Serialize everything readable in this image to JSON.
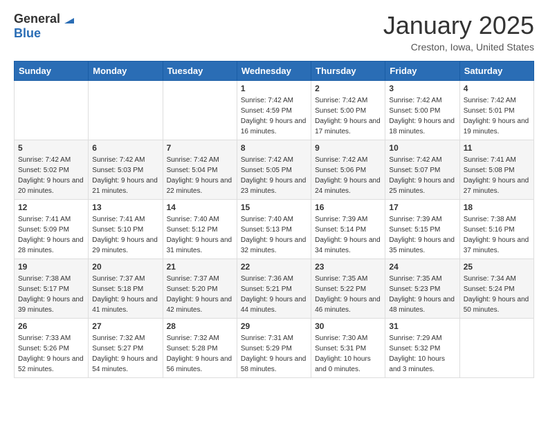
{
  "logo": {
    "general": "General",
    "blue": "Blue"
  },
  "header": {
    "month": "January 2025",
    "location": "Creston, Iowa, United States"
  },
  "weekdays": [
    "Sunday",
    "Monday",
    "Tuesday",
    "Wednesday",
    "Thursday",
    "Friday",
    "Saturday"
  ],
  "weeks": [
    [
      {
        "day": "",
        "sunrise": "",
        "sunset": "",
        "daylight": ""
      },
      {
        "day": "",
        "sunrise": "",
        "sunset": "",
        "daylight": ""
      },
      {
        "day": "",
        "sunrise": "",
        "sunset": "",
        "daylight": ""
      },
      {
        "day": "1",
        "sunrise": "Sunrise: 7:42 AM",
        "sunset": "Sunset: 4:59 PM",
        "daylight": "Daylight: 9 hours and 16 minutes."
      },
      {
        "day": "2",
        "sunrise": "Sunrise: 7:42 AM",
        "sunset": "Sunset: 5:00 PM",
        "daylight": "Daylight: 9 hours and 17 minutes."
      },
      {
        "day": "3",
        "sunrise": "Sunrise: 7:42 AM",
        "sunset": "Sunset: 5:00 PM",
        "daylight": "Daylight: 9 hours and 18 minutes."
      },
      {
        "day": "4",
        "sunrise": "Sunrise: 7:42 AM",
        "sunset": "Sunset: 5:01 PM",
        "daylight": "Daylight: 9 hours and 19 minutes."
      }
    ],
    [
      {
        "day": "5",
        "sunrise": "Sunrise: 7:42 AM",
        "sunset": "Sunset: 5:02 PM",
        "daylight": "Daylight: 9 hours and 20 minutes."
      },
      {
        "day": "6",
        "sunrise": "Sunrise: 7:42 AM",
        "sunset": "Sunset: 5:03 PM",
        "daylight": "Daylight: 9 hours and 21 minutes."
      },
      {
        "day": "7",
        "sunrise": "Sunrise: 7:42 AM",
        "sunset": "Sunset: 5:04 PM",
        "daylight": "Daylight: 9 hours and 22 minutes."
      },
      {
        "day": "8",
        "sunrise": "Sunrise: 7:42 AM",
        "sunset": "Sunset: 5:05 PM",
        "daylight": "Daylight: 9 hours and 23 minutes."
      },
      {
        "day": "9",
        "sunrise": "Sunrise: 7:42 AM",
        "sunset": "Sunset: 5:06 PM",
        "daylight": "Daylight: 9 hours and 24 minutes."
      },
      {
        "day": "10",
        "sunrise": "Sunrise: 7:42 AM",
        "sunset": "Sunset: 5:07 PM",
        "daylight": "Daylight: 9 hours and 25 minutes."
      },
      {
        "day": "11",
        "sunrise": "Sunrise: 7:41 AM",
        "sunset": "Sunset: 5:08 PM",
        "daylight": "Daylight: 9 hours and 27 minutes."
      }
    ],
    [
      {
        "day": "12",
        "sunrise": "Sunrise: 7:41 AM",
        "sunset": "Sunset: 5:09 PM",
        "daylight": "Daylight: 9 hours and 28 minutes."
      },
      {
        "day": "13",
        "sunrise": "Sunrise: 7:41 AM",
        "sunset": "Sunset: 5:10 PM",
        "daylight": "Daylight: 9 hours and 29 minutes."
      },
      {
        "day": "14",
        "sunrise": "Sunrise: 7:40 AM",
        "sunset": "Sunset: 5:12 PM",
        "daylight": "Daylight: 9 hours and 31 minutes."
      },
      {
        "day": "15",
        "sunrise": "Sunrise: 7:40 AM",
        "sunset": "Sunset: 5:13 PM",
        "daylight": "Daylight: 9 hours and 32 minutes."
      },
      {
        "day": "16",
        "sunrise": "Sunrise: 7:39 AM",
        "sunset": "Sunset: 5:14 PM",
        "daylight": "Daylight: 9 hours and 34 minutes."
      },
      {
        "day": "17",
        "sunrise": "Sunrise: 7:39 AM",
        "sunset": "Sunset: 5:15 PM",
        "daylight": "Daylight: 9 hours and 35 minutes."
      },
      {
        "day": "18",
        "sunrise": "Sunrise: 7:38 AM",
        "sunset": "Sunset: 5:16 PM",
        "daylight": "Daylight: 9 hours and 37 minutes."
      }
    ],
    [
      {
        "day": "19",
        "sunrise": "Sunrise: 7:38 AM",
        "sunset": "Sunset: 5:17 PM",
        "daylight": "Daylight: 9 hours and 39 minutes."
      },
      {
        "day": "20",
        "sunrise": "Sunrise: 7:37 AM",
        "sunset": "Sunset: 5:18 PM",
        "daylight": "Daylight: 9 hours and 41 minutes."
      },
      {
        "day": "21",
        "sunrise": "Sunrise: 7:37 AM",
        "sunset": "Sunset: 5:20 PM",
        "daylight": "Daylight: 9 hours and 42 minutes."
      },
      {
        "day": "22",
        "sunrise": "Sunrise: 7:36 AM",
        "sunset": "Sunset: 5:21 PM",
        "daylight": "Daylight: 9 hours and 44 minutes."
      },
      {
        "day": "23",
        "sunrise": "Sunrise: 7:35 AM",
        "sunset": "Sunset: 5:22 PM",
        "daylight": "Daylight: 9 hours and 46 minutes."
      },
      {
        "day": "24",
        "sunrise": "Sunrise: 7:35 AM",
        "sunset": "Sunset: 5:23 PM",
        "daylight": "Daylight: 9 hours and 48 minutes."
      },
      {
        "day": "25",
        "sunrise": "Sunrise: 7:34 AM",
        "sunset": "Sunset: 5:24 PM",
        "daylight": "Daylight: 9 hours and 50 minutes."
      }
    ],
    [
      {
        "day": "26",
        "sunrise": "Sunrise: 7:33 AM",
        "sunset": "Sunset: 5:26 PM",
        "daylight": "Daylight: 9 hours and 52 minutes."
      },
      {
        "day": "27",
        "sunrise": "Sunrise: 7:32 AM",
        "sunset": "Sunset: 5:27 PM",
        "daylight": "Daylight: 9 hours and 54 minutes."
      },
      {
        "day": "28",
        "sunrise": "Sunrise: 7:32 AM",
        "sunset": "Sunset: 5:28 PM",
        "daylight": "Daylight: 9 hours and 56 minutes."
      },
      {
        "day": "29",
        "sunrise": "Sunrise: 7:31 AM",
        "sunset": "Sunset: 5:29 PM",
        "daylight": "Daylight: 9 hours and 58 minutes."
      },
      {
        "day": "30",
        "sunrise": "Sunrise: 7:30 AM",
        "sunset": "Sunset: 5:31 PM",
        "daylight": "Daylight: 10 hours and 0 minutes."
      },
      {
        "day": "31",
        "sunrise": "Sunrise: 7:29 AM",
        "sunset": "Sunset: 5:32 PM",
        "daylight": "Daylight: 10 hours and 3 minutes."
      },
      {
        "day": "",
        "sunrise": "",
        "sunset": "",
        "daylight": ""
      }
    ]
  ]
}
